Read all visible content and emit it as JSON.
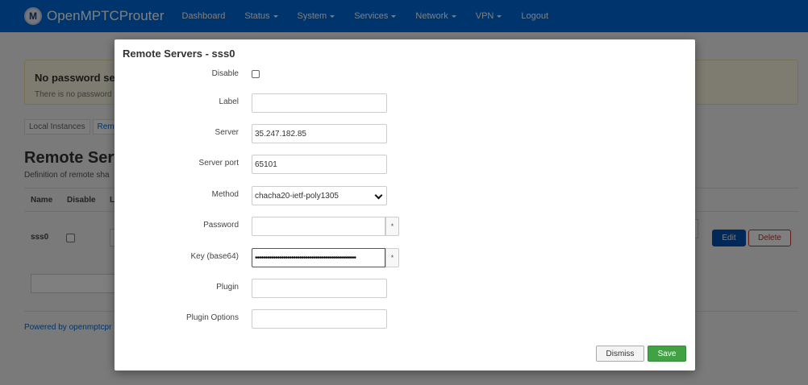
{
  "navbar": {
    "brand": "OpenMPTCProuter",
    "logo_icon": "openmptcprouter-logo",
    "items": [
      {
        "label": "Dashboard",
        "dropdown": false
      },
      {
        "label": "Status",
        "dropdown": true
      },
      {
        "label": "System",
        "dropdown": true
      },
      {
        "label": "Services",
        "dropdown": true
      },
      {
        "label": "Network",
        "dropdown": true
      },
      {
        "label": "VPN",
        "dropdown": true
      },
      {
        "label": "Logout",
        "dropdown": false
      }
    ],
    "color": "#0069d9"
  },
  "background": {
    "alert_title": "No password se",
    "alert_text": "There is no password",
    "tabs": [
      "Local Instances",
      "Rem"
    ],
    "section_title": "Remote Serv",
    "section_desc": "Definition of remote sha",
    "table_headers": [
      "Name",
      "Disable",
      "L"
    ],
    "row": {
      "name": "sss0",
      "edit_label": "Edit",
      "delete_label": "Delete"
    },
    "powered_by": "Powered by openmptcpr"
  },
  "modal": {
    "title": "Remote Servers - sss0",
    "fields": {
      "disable": {
        "label": "Disable",
        "checked": false
      },
      "label": {
        "label": "Label",
        "value": ""
      },
      "server": {
        "label": "Server",
        "value": "35.247.182.85"
      },
      "server_port": {
        "label": "Server port",
        "value": "65101"
      },
      "method": {
        "label": "Method",
        "value": "chacha20-ietf-poly1305"
      },
      "password": {
        "label": "Password",
        "value": ""
      },
      "key": {
        "label": "Key (base64)",
        "value": "••••••••••••••••••••••••••••••••••••••••••••••••••"
      },
      "plugin": {
        "label": "Plugin",
        "value": ""
      },
      "plugin_options": {
        "label": "Plugin Options",
        "value": ""
      }
    },
    "reveal_glyph": "*",
    "dismiss_label": "Dismiss",
    "save_label": "Save",
    "save_color": "#41a244"
  }
}
